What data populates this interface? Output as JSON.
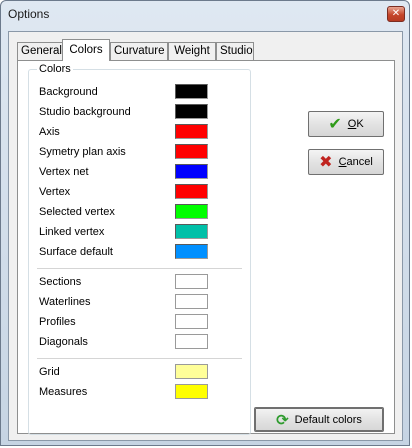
{
  "window": {
    "title": "Options",
    "close_glyph": "✕"
  },
  "tabs": [
    {
      "label": "General",
      "active": false
    },
    {
      "label": "Colors",
      "active": true
    },
    {
      "label": "Curvature",
      "active": false
    },
    {
      "label": "Weight",
      "active": false
    },
    {
      "label": "Studio",
      "active": false
    }
  ],
  "colors_group": {
    "title": "Colors",
    "rows": [
      {
        "label": "Background",
        "color": "#000000"
      },
      {
        "label": "Studio background",
        "color": "#000000"
      },
      {
        "label": "Axis",
        "color": "#ff0000"
      },
      {
        "label": "Symetry plan axis",
        "color": "#ff0000"
      },
      {
        "label": "Vertex net",
        "color": "#0000ff"
      },
      {
        "label": "Vertex",
        "color": "#ff0000"
      },
      {
        "label": "Selected vertex",
        "color": "#00ff00"
      },
      {
        "label": "Linked vertex",
        "color": "#00c0a8"
      },
      {
        "label": "Surface default",
        "color": "#0090ff"
      },
      {
        "label": "Sections",
        "color": "#ffffff"
      },
      {
        "label": "Waterlines",
        "color": "#ffffff"
      },
      {
        "label": "Profiles",
        "color": "#ffffff"
      },
      {
        "label": "Diagonals",
        "color": "#ffffff"
      },
      {
        "label": "Grid",
        "color": "#ffff99"
      },
      {
        "label": "Measures",
        "color": "#ffff00"
      }
    ]
  },
  "buttons": {
    "ok": {
      "label": "OK",
      "mnemonic": "O",
      "rest": "K",
      "icon": "check-icon"
    },
    "cancel": {
      "label": "Cancel",
      "mnemonic": "C",
      "rest": "ancel",
      "icon": "x-icon"
    },
    "default_colors": {
      "label": "Default colors",
      "icon": "refresh-icon"
    }
  }
}
